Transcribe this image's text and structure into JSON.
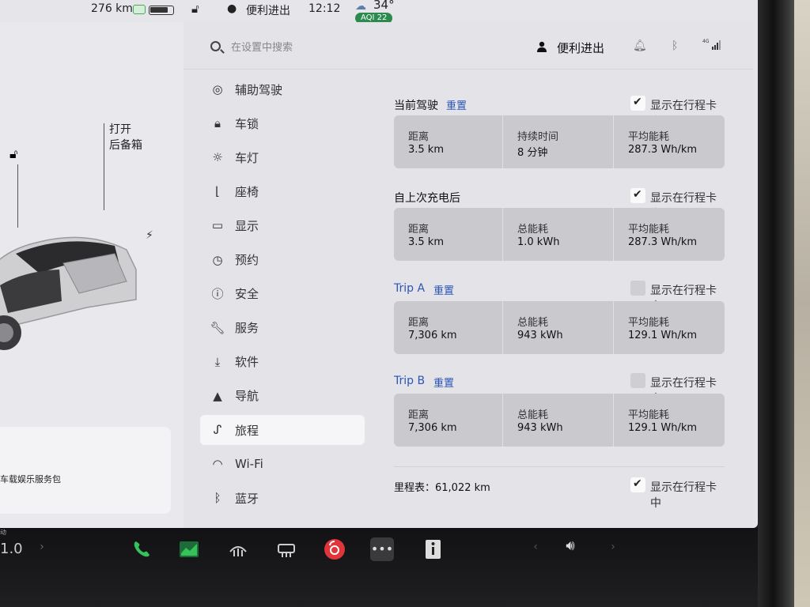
{
  "status": {
    "range": "276 km",
    "user": "便利进出",
    "time": "12:12",
    "temp": "34°",
    "aqi": "AQI 22"
  },
  "car": {
    "trunk_label_line1": "打开",
    "trunk_label_line2": "后备箱",
    "media_card_text": "车载娱乐服务包"
  },
  "search": {
    "placeholder": "在设置中搜索"
  },
  "header": {
    "profile_name": "便利进出"
  },
  "nav": [
    {
      "label": "辅助驾驶",
      "icon": "steering-wheel-icon"
    },
    {
      "label": "车锁",
      "icon": "lock-icon"
    },
    {
      "label": "车灯",
      "icon": "light-icon"
    },
    {
      "label": "座椅",
      "icon": "seat-icon"
    },
    {
      "label": "显示",
      "icon": "display-icon"
    },
    {
      "label": "预约",
      "icon": "schedule-icon"
    },
    {
      "label": "安全",
      "icon": "safety-icon"
    },
    {
      "label": "服务",
      "icon": "wrench-icon"
    },
    {
      "label": "软件",
      "icon": "download-icon"
    },
    {
      "label": "导航",
      "icon": "navigation-icon"
    },
    {
      "label": "旅程",
      "icon": "trips-icon"
    },
    {
      "label": "Wi-Fi",
      "icon": "wifi-icon"
    },
    {
      "label": "蓝牙",
      "icon": "bluetooth-icon"
    }
  ],
  "active_nav": "旅程",
  "trips": {
    "current": {
      "title": "当前驾驶",
      "reset": "重置",
      "show_label": "显示在行程卡中",
      "checked": true,
      "cells": [
        {
          "k": "距离",
          "v": "3.5 km"
        },
        {
          "k": "持续时间",
          "v": "8 分钟"
        },
        {
          "k": "平均能耗",
          "v": "287.3 Wh/km"
        }
      ]
    },
    "since_charge": {
      "title": "自上次充电后",
      "show_label": "显示在行程卡中",
      "checked": true,
      "cells": [
        {
          "k": "距离",
          "v": "3.5 km"
        },
        {
          "k": "总能耗",
          "v": "1.0 kWh"
        },
        {
          "k": "平均能耗",
          "v": "287.3 Wh/km"
        }
      ]
    },
    "trip_a": {
      "title": "Trip A",
      "reset": "重置",
      "show_label": "显示在行程卡中",
      "checked": false,
      "cells": [
        {
          "k": "距离",
          "v": "7,306 km"
        },
        {
          "k": "总能耗",
          "v": "943 kWh"
        },
        {
          "k": "平均能耗",
          "v": "129.1 Wh/km"
        }
      ]
    },
    "trip_b": {
      "title": "Trip B",
      "reset": "重置",
      "show_label": "显示在行程卡中",
      "checked": false,
      "cells": [
        {
          "k": "距离",
          "v": "7,306 km"
        },
        {
          "k": "总能耗",
          "v": "943 kWh"
        },
        {
          "k": "平均能耗",
          "v": "129.1 Wh/km"
        }
      ]
    },
    "odometer": {
      "text": "里程表：61,022 km",
      "show_label": "显示在行程卡中",
      "checked": true
    }
  },
  "dock": {
    "cabin_temp": "1.0"
  },
  "colors": {
    "accent": "#2b55b7",
    "phone_green": "#36c25a",
    "netease_red": "#e0353b"
  }
}
